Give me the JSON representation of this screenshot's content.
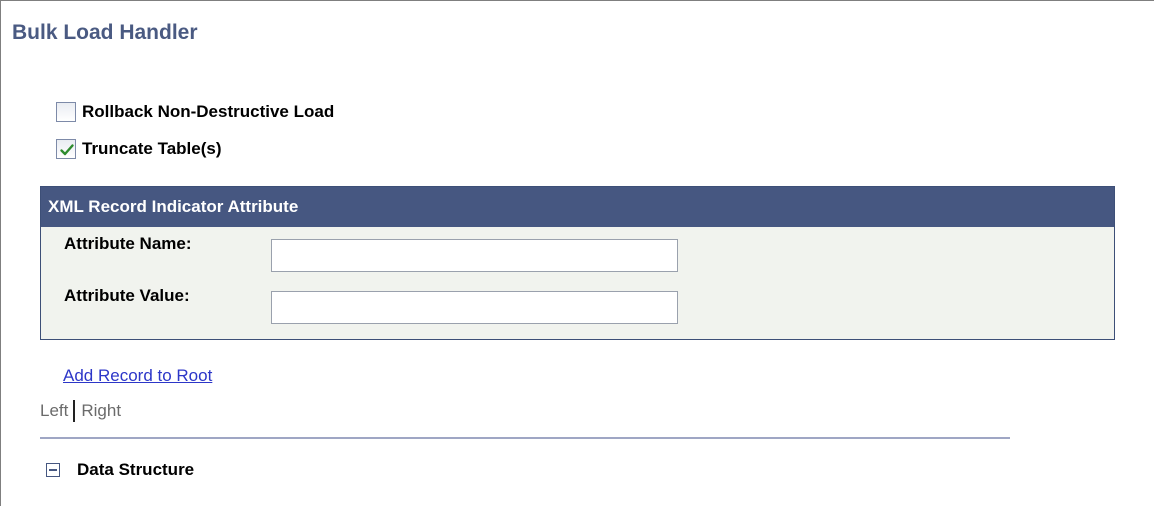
{
  "page": {
    "title": "Bulk Load Handler"
  },
  "options": [
    {
      "label": "Rollback Non-Destructive Load",
      "checked": false
    },
    {
      "label": "Truncate Table(s)",
      "checked": true
    }
  ],
  "xml_record": {
    "header": "XML Record Indicator Attribute",
    "attribute_name_label": "Attribute Name:",
    "attribute_name_value": "",
    "attribute_value_label": "Attribute Value:",
    "attribute_value_value": ""
  },
  "actions": {
    "add_record_link": "Add Record to Root"
  },
  "layout_toggle": {
    "left": "Left",
    "right": "Right"
  },
  "section": {
    "label": "Data Structure",
    "icon": "collapse-icon"
  },
  "colors": {
    "title": "#4a5a82",
    "group_header_bg": "#465781",
    "group_body_bg": "#f1f3ee",
    "link": "#2c36c8",
    "check_green": "#2e8b2e"
  }
}
